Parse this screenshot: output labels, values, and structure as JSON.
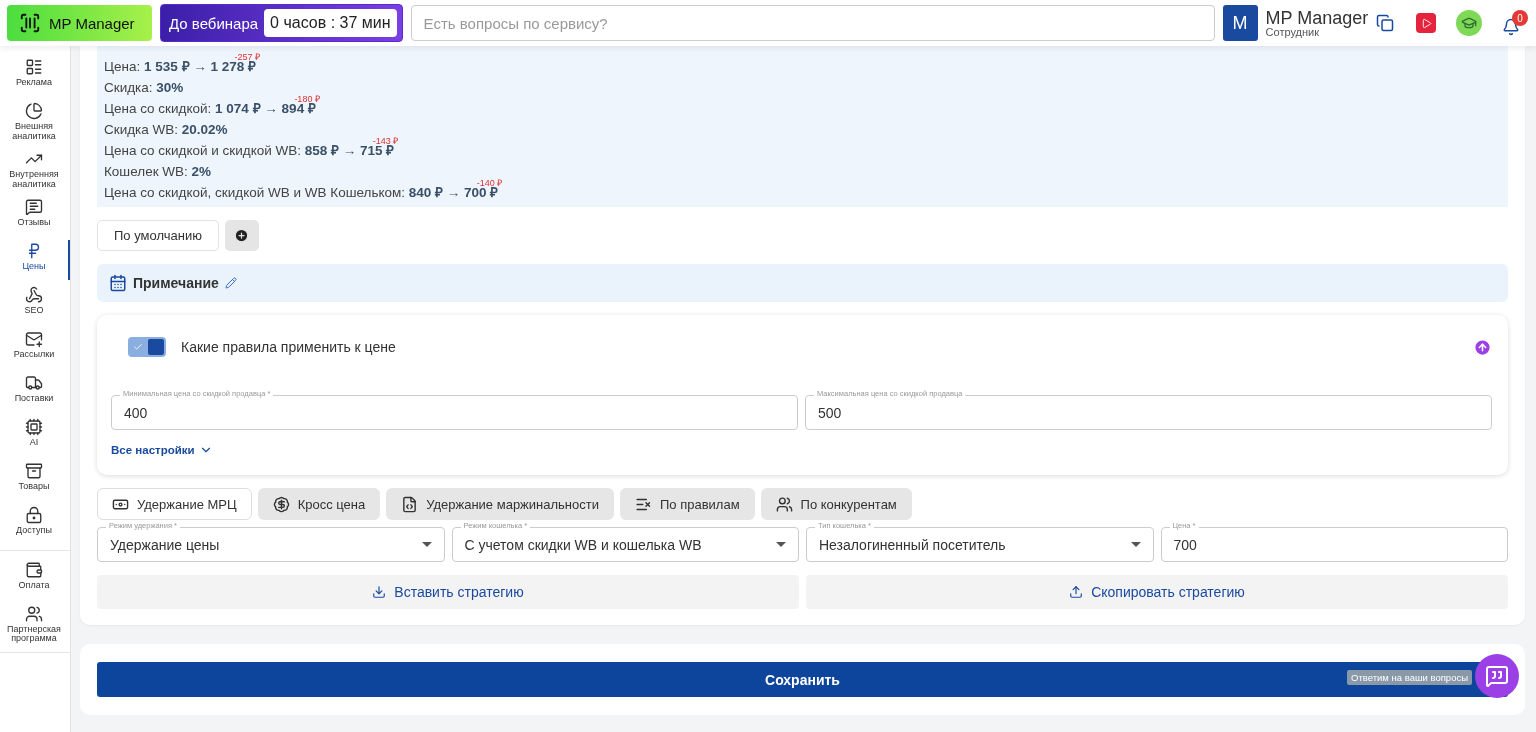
{
  "header": {
    "logo_text": "MP Manager",
    "webinar_label": "До вебинара",
    "timer": "0 часов : 37 мин",
    "search_placeholder": "Есть вопросы по сервису?",
    "user": {
      "initial": "M",
      "name": "MP Manager",
      "role": "Сотрудник"
    },
    "notifications": "0"
  },
  "sidebar": {
    "groups": [
      [
        {
          "label": "Реклама",
          "selected": false
        },
        {
          "label": "Внешняя аналитика",
          "selected": false
        },
        {
          "label": "Внутренняя аналитика",
          "selected": false
        },
        {
          "label": "Отзывы",
          "selected": false
        },
        {
          "label": "Цены",
          "selected": true
        },
        {
          "label": "SEO",
          "selected": false
        },
        {
          "label": "Рассылки",
          "selected": false
        },
        {
          "label": "Поставки",
          "selected": false
        },
        {
          "label": "AI",
          "selected": false
        },
        {
          "label": "Товары",
          "selected": false
        },
        {
          "label": "Доступы",
          "selected": false
        }
      ],
      [
        {
          "label": "Оплата",
          "selected": false
        },
        {
          "label": "Партнерская программа",
          "selected": false
        }
      ]
    ]
  },
  "price_info": {
    "lines": [
      {
        "label": "Цена:",
        "value": "1 535 ₽ → 1 278 ₽",
        "delta": "-257 ₽"
      },
      {
        "label": "Скидка:",
        "value": "30%"
      },
      {
        "label": "Цена со скидкой:",
        "value": "1 074 ₽ → 894 ₽",
        "delta": "-180 ₽"
      },
      {
        "label": "Скидка WB:",
        "value": "20.02%"
      },
      {
        "label": "Цена со скидкой и скидкой WB:",
        "value": "858 ₽ → 715 ₽",
        "delta": "-143 ₽"
      },
      {
        "label": "Кошелек WB:",
        "value": "2%"
      },
      {
        "label": "Цена со скидкой, скидкой WB и WB Кошельком:",
        "value": "840 ₽ → 700 ₽",
        "delta": "-140 ₽"
      }
    ]
  },
  "presets": [
    {
      "label": "По умолчанию",
      "selected": true
    }
  ],
  "note": {
    "title": "Примечание"
  },
  "rules": {
    "title": "Какие правила применить к цене",
    "enabled": true,
    "fields": [
      {
        "label": "Минимальная цена со скидкой продавца *",
        "value": "400"
      },
      {
        "label": "Максимальная цена со скидкой продавца",
        "value": "500"
      }
    ],
    "all_settings": "Все настройки"
  },
  "strategy_tabs": [
    {
      "label": "Удержание МРЦ",
      "selected": true
    },
    {
      "label": "Кросс цена",
      "selected": false
    },
    {
      "label": "Удержание маржинальности",
      "selected": false
    },
    {
      "label": "По правилам",
      "selected": false
    },
    {
      "label": "По конкурентам",
      "selected": false
    }
  ],
  "strategy_fields": [
    {
      "kind": "select",
      "label": "Режим удержания *",
      "value": "Удержание цены"
    },
    {
      "kind": "select",
      "label": "Режим кошелька *",
      "value": "С учетом скидки WB и кошелька WB"
    },
    {
      "kind": "select",
      "label": "Тип кошелька *",
      "value": "Незалогиненный посетитель"
    },
    {
      "kind": "input",
      "label": "Цена *",
      "value": "700"
    }
  ],
  "actions": [
    "Вставить стратегию",
    "Скопировать стратегию"
  ],
  "save_button": "Сохранить",
  "chat_tooltip": "Ответим на ваши вопросы"
}
